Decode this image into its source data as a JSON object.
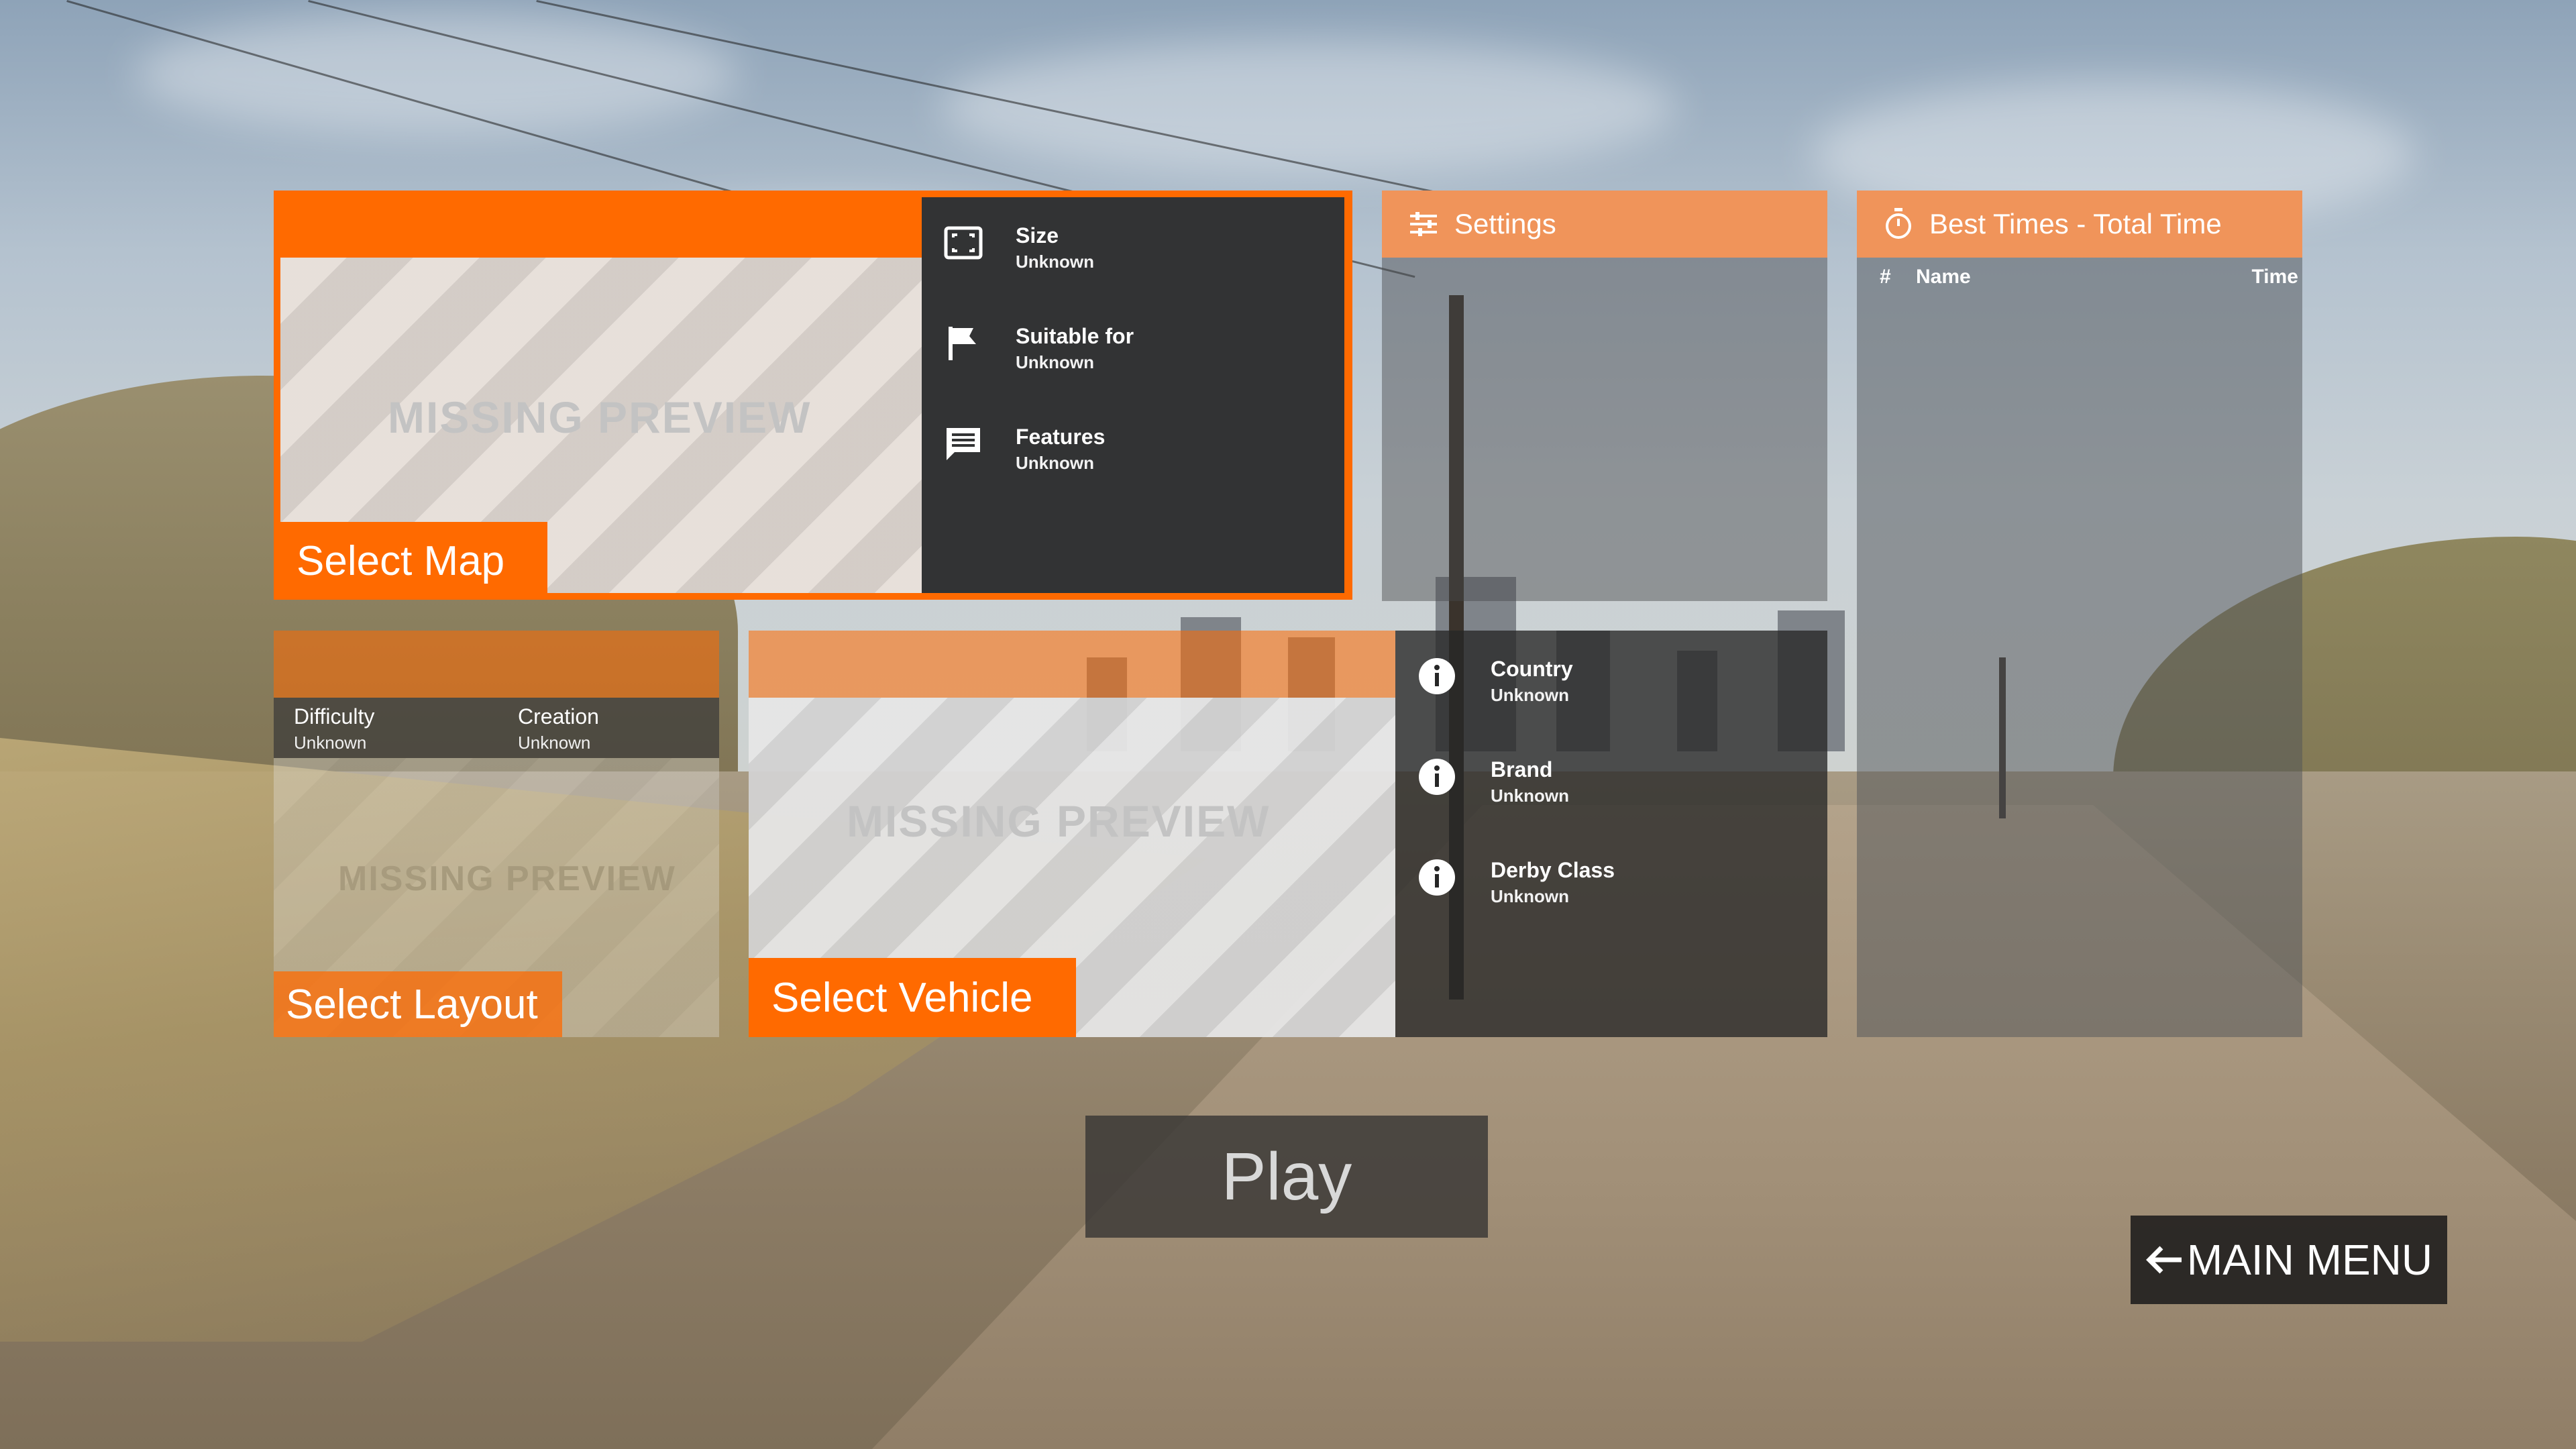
{
  "map_panel": {
    "missing_preview": "MISSING PREVIEW",
    "select_label": "Select Map",
    "info": [
      {
        "icon": "fullscreen-icon",
        "label": "Size",
        "value": "Unknown"
      },
      {
        "icon": "flag-icon",
        "label": "Suitable for",
        "value": "Unknown"
      },
      {
        "icon": "chat-icon",
        "label": "Features",
        "value": "Unknown"
      }
    ]
  },
  "layout_panel": {
    "difficulty_label": "Difficulty",
    "difficulty_value": "Unknown",
    "creation_label": "Creation",
    "creation_value": "Unknown",
    "missing_preview": "MISSING PREVIEW",
    "select_label": "Select Layout"
  },
  "vehicle_panel": {
    "missing_preview": "MISSING PREVIEW",
    "select_label": "Select Vehicle",
    "info": [
      {
        "icon": "info-icon",
        "label": "Country",
        "value": "Unknown"
      },
      {
        "icon": "info-icon",
        "label": "Brand",
        "value": "Unknown"
      },
      {
        "icon": "info-icon",
        "label": "Derby Class",
        "value": "Unknown"
      }
    ]
  },
  "settings_panel": {
    "title": "Settings",
    "icon": "sliders-icon"
  },
  "best_times_panel": {
    "title": "Best Times - Total Time",
    "icon": "stopwatch-icon",
    "columns": [
      "#",
      "Name",
      "Time"
    ],
    "rows": []
  },
  "play_label": "Play",
  "main_menu_label": "MAIN MENU",
  "colors": {
    "accent": "#ff6a00",
    "accent_light": "#f0945a",
    "dark_panel": "#2d2d2d"
  }
}
